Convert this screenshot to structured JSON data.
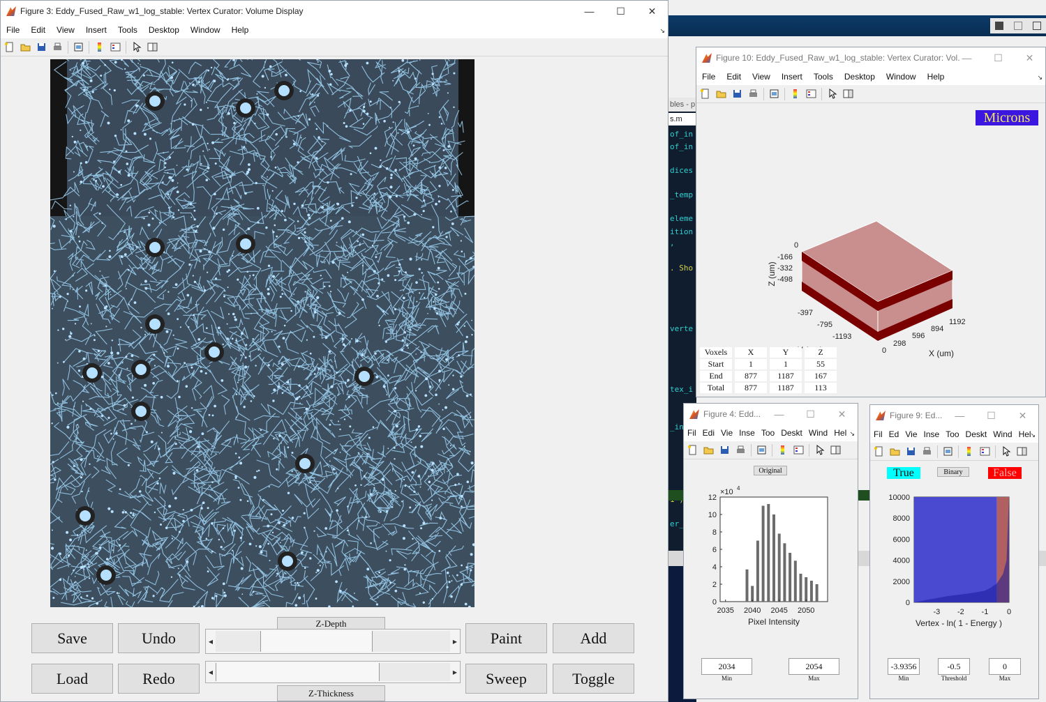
{
  "main_window": {
    "title": "Figure 3: Eddy_Fused_Raw_w1_log_stable: Vertex Curator: Volume Display",
    "menu": [
      "File",
      "Edit",
      "View",
      "Insert",
      "Tools",
      "Desktop",
      "Window",
      "Help"
    ],
    "buttons": {
      "save": "Save",
      "undo": "Undo",
      "load": "Load",
      "redo": "Redo",
      "paint": "Paint",
      "add": "Add",
      "sweep": "Sweep",
      "toggle": "Toggle"
    },
    "z_depth_label": "Z-Depth",
    "z_thickness_label": "Z-Thickness",
    "z_depth_slider": {
      "thumb_start": 0.19,
      "thumb_end": 0.67
    },
    "z_thickness_slider": {
      "thumb_start": 0.0,
      "thumb_end": 0.7
    }
  },
  "background_editor": {
    "tab_text": "bles - p",
    "file_tab": "s.m",
    "code_lines": [
      "of_in",
      "of_in",
      "dices",
      "_temp",
      "eleme",
      "ition",
      "   ,",
      ". Sho",
      "verte",
      "tex_i",
      "_in",
      "1 )",
      "er_",
      "ect"
    ]
  },
  "figure10": {
    "title": "Figure 10: Eddy_Fused_Raw_w1_log_stable: Vertex Curator: Vol...",
    "menu": [
      "File",
      "Edit",
      "View",
      "Insert",
      "Tools",
      "Desktop",
      "Window",
      "Help"
    ],
    "units_button": "Microns",
    "axes": {
      "z_label": "Z (um)",
      "y_label": "Y (um)",
      "x_label": "X (um)",
      "z_ticks": [
        "0",
        "-166",
        "-332",
        "-498"
      ],
      "y_ticks": [
        "-397",
        "-795",
        "-1193"
      ],
      "x_ticks": [
        "0",
        "298",
        "596",
        "894",
        "1192"
      ]
    },
    "voxel_table": {
      "header": [
        "Voxels",
        "X",
        "Y",
        "Z"
      ],
      "rows": [
        [
          "Start",
          "1",
          "1",
          "55"
        ],
        [
          "End",
          "877",
          "1187",
          "167"
        ],
        [
          "Total",
          "877",
          "1187",
          "113"
        ]
      ]
    },
    "colors": {
      "box_face": "#c98f8f",
      "box_band": "#7a0000",
      "units_bg": "#3a16e0",
      "units_text": "#f2e35c"
    }
  },
  "figure4": {
    "title": "Figure 4: Edd...",
    "menu": [
      "Fil",
      "Edi",
      "Vie",
      "Inse",
      "Too",
      "Deskt",
      "Wind",
      "Hel"
    ],
    "mode_button": "Original",
    "min_value": "2034",
    "max_value": "2054",
    "min_caption": "Min",
    "max_caption": "Max"
  },
  "figure9": {
    "title": "Figure 9: Ed...",
    "menu": [
      "Fil",
      "Ed",
      "Vie",
      "Inse",
      "Too",
      "Deskt",
      "Wind",
      "Hel"
    ],
    "true_label": "True",
    "binary_button": "Binary",
    "false_label": "False",
    "min_value": "-3.9356",
    "threshold_value": "-0.5",
    "max_value": "0",
    "min_caption": "Min",
    "threshold_caption": "Threshold",
    "max_caption": "Max",
    "colors": {
      "true_bg": "#00ffff",
      "false_bg": "#ff0000",
      "fill_true": "#4a4ad0",
      "fill_false": "#b06060"
    }
  },
  "chart_data": [
    {
      "type": "bar",
      "xlabel": "Pixel Intensity",
      "ylabel": "",
      "exponent_label": "×10",
      "exponent_power": "4",
      "x": [
        2036,
        2037,
        2038,
        2039,
        2040,
        2041,
        2042,
        2043,
        2044,
        2045,
        2046,
        2047,
        2048,
        2049,
        2050,
        2051,
        2052
      ],
      "values": [
        0,
        0,
        0,
        3.7,
        1.8,
        7.0,
        11.0,
        11.2,
        10.0,
        7.8,
        6.7,
        5.6,
        4.7,
        3.2,
        2.8,
        2.4,
        2.0
      ],
      "xlim": [
        2034,
        2054
      ],
      "ylim": [
        0,
        12
      ],
      "x_ticks": [
        "2035",
        "2040",
        "2045",
        "2050"
      ],
      "y_ticks": [
        "0",
        "2",
        "4",
        "6",
        "8",
        "10",
        "12"
      ]
    },
    {
      "type": "area",
      "xlabel": "Vertex - ln( 1 - Energy )",
      "ylabel": "",
      "x": [
        -3.9,
        -3.5,
        -3.0,
        -2.5,
        -2.0,
        -1.5,
        -1.0,
        -0.75,
        -0.5,
        -0.25,
        -0.1,
        0
      ],
      "values": [
        0,
        200,
        400,
        600,
        750,
        900,
        1100,
        1400,
        1800,
        2700,
        4000,
        10000
      ],
      "threshold": -0.5,
      "xlim": [
        -3.9356,
        0
      ],
      "ylim": [
        0,
        10000
      ],
      "x_ticks": [
        "-3",
        "-2",
        "-1",
        "0"
      ],
      "y_ticks": [
        "0",
        "2000",
        "4000",
        "6000",
        "8000",
        "10000"
      ]
    }
  ]
}
